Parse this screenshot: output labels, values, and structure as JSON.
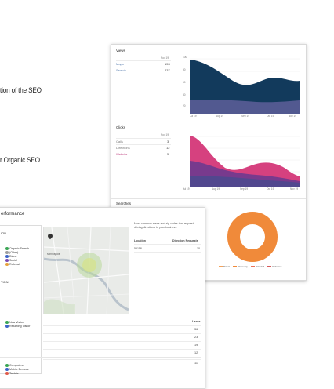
{
  "side_text": {
    "line1": "tion of the SEO",
    "line2": "r Organic SEO"
  },
  "views": {
    "title": "Views",
    "col_header": "Nov 19",
    "rows": [
      {
        "label": "Maps",
        "value": "153"
      },
      {
        "label": "Search",
        "value": "437"
      }
    ],
    "y_ticks": [
      "100",
      "80",
      "60",
      "40",
      "20",
      ""
    ],
    "x_ticks": [
      "Jul 19",
      "Aug 19",
      "Sep 19",
      "Oct 19",
      "Nov 19"
    ]
  },
  "clicks": {
    "title": "Clicks",
    "col_header": "Nov 19",
    "rows": [
      {
        "label": "Calls",
        "value": "3"
      },
      {
        "label": "Directions",
        "value": "12"
      },
      {
        "label": "Website",
        "value": "5"
      }
    ],
    "x_ticks": [
      "Jul 19",
      "Aug 19",
      "Sep 19",
      "Oct 19",
      "Nov 19"
    ]
  },
  "searches": {
    "title": "Searches",
    "legend": [
      "Direct",
      "Discovery",
      "Branded",
      "Unknown"
    ]
  },
  "performance": {
    "title": "erformance",
    "acq_title": "ION",
    "acq_legend": [
      "Organic Search",
      "(Other)",
      "Direct",
      "Social",
      "Referral"
    ],
    "users_title": "TION",
    "users_legend": [
      "New Visitor",
      "Returning Visitor"
    ],
    "devices_legend": [
      "Computers",
      "Mobile Devices",
      "Tablets"
    ],
    "map_label": "Minneapolis",
    "description": "Most common areas and zip codes that request driving directions to your business.",
    "location_header": "Location",
    "requests_header": "Direction Requests",
    "location_row": {
      "zip": "55118",
      "count": "10"
    },
    "users_header": "Users",
    "users_values": [
      "36",
      "23",
      "19",
      "12",
      "11"
    ]
  }
}
